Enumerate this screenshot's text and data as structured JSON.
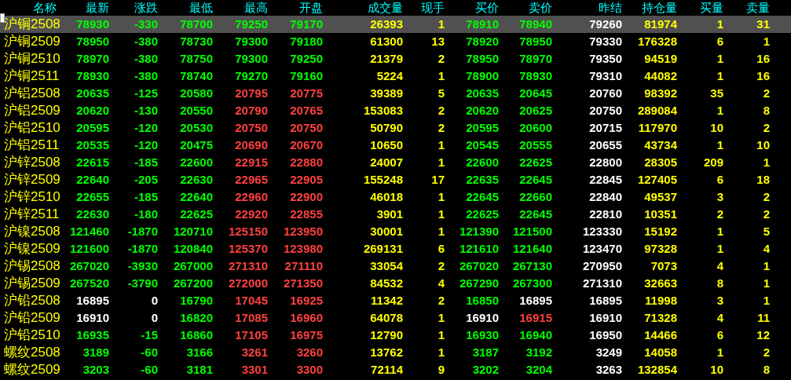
{
  "columns": [
    "名称",
    "最新",
    "涨跌",
    "最低",
    "最高",
    "开盘",
    "成交量",
    "现手",
    "买价",
    "卖价",
    "昨结",
    "持仓量",
    "买量",
    "卖量"
  ],
  "rows": [
    {
      "selected": true,
      "cells": [
        "沪铜2508",
        "78930",
        "-330",
        "78700",
        "79250",
        "79170",
        "26393",
        "1",
        "78910",
        "78940",
        "79260",
        "81974",
        "1",
        "31"
      ]
    },
    {
      "selected": false,
      "cells": [
        "沪铜2509",
        "78950",
        "-380",
        "78730",
        "79300",
        "79180",
        "61300",
        "13",
        "78920",
        "78950",
        "79330",
        "176328",
        "6",
        "1"
      ]
    },
    {
      "selected": false,
      "cells": [
        "沪铜2510",
        "78970",
        "-380",
        "78750",
        "79300",
        "79250",
        "21379",
        "2",
        "78950",
        "78970",
        "79350",
        "94519",
        "1",
        "16"
      ]
    },
    {
      "selected": false,
      "cells": [
        "沪铜2511",
        "78930",
        "-380",
        "78740",
        "79270",
        "79160",
        "5224",
        "1",
        "78900",
        "78930",
        "79310",
        "44082",
        "1",
        "16"
      ]
    },
    {
      "selected": false,
      "cells": [
        "沪铝2508",
        "20635",
        "-125",
        "20580",
        "20795",
        "20775",
        "39389",
        "5",
        "20635",
        "20645",
        "20760",
        "98392",
        "35",
        "2"
      ]
    },
    {
      "selected": false,
      "cells": [
        "沪铝2509",
        "20620",
        "-130",
        "20550",
        "20790",
        "20765",
        "153083",
        "2",
        "20620",
        "20625",
        "20750",
        "289084",
        "1",
        "8"
      ]
    },
    {
      "selected": false,
      "cells": [
        "沪铝2510",
        "20595",
        "-120",
        "20530",
        "20750",
        "20750",
        "50790",
        "2",
        "20595",
        "20600",
        "20715",
        "117970",
        "10",
        "2"
      ]
    },
    {
      "selected": false,
      "cells": [
        "沪铝2511",
        "20535",
        "-120",
        "20475",
        "20690",
        "20670",
        "10650",
        "1",
        "20545",
        "20555",
        "20655",
        "43734",
        "1",
        "10"
      ]
    },
    {
      "selected": false,
      "cells": [
        "沪锌2508",
        "22615",
        "-185",
        "22600",
        "22915",
        "22880",
        "24007",
        "1",
        "22600",
        "22625",
        "22800",
        "28305",
        "209",
        "1"
      ]
    },
    {
      "selected": false,
      "cells": [
        "沪锌2509",
        "22640",
        "-205",
        "22630",
        "22965",
        "22905",
        "155248",
        "17",
        "22635",
        "22645",
        "22845",
        "127405",
        "6",
        "18"
      ]
    },
    {
      "selected": false,
      "cells": [
        "沪锌2510",
        "22655",
        "-185",
        "22640",
        "22960",
        "22900",
        "46018",
        "1",
        "22645",
        "22660",
        "22840",
        "49537",
        "3",
        "2"
      ]
    },
    {
      "selected": false,
      "cells": [
        "沪锌2511",
        "22630",
        "-180",
        "22625",
        "22920",
        "22855",
        "3901",
        "1",
        "22625",
        "22645",
        "22810",
        "10351",
        "2",
        "2"
      ]
    },
    {
      "selected": false,
      "cells": [
        "沪镍2508",
        "121460",
        "-1870",
        "120710",
        "125150",
        "123950",
        "30001",
        "1",
        "121390",
        "121500",
        "123330",
        "15192",
        "1",
        "5"
      ]
    },
    {
      "selected": false,
      "cells": [
        "沪镍2509",
        "121600",
        "-1870",
        "120840",
        "125370",
        "123980",
        "269131",
        "6",
        "121610",
        "121640",
        "123470",
        "97328",
        "1",
        "4"
      ]
    },
    {
      "selected": false,
      "cells": [
        "沪锡2508",
        "267020",
        "-3930",
        "267000",
        "271310",
        "271110",
        "33054",
        "2",
        "267020",
        "267130",
        "270950",
        "7073",
        "4",
        "1"
      ]
    },
    {
      "selected": false,
      "cells": [
        "沪锡2509",
        "267520",
        "-3790",
        "267200",
        "272000",
        "271350",
        "84532",
        "4",
        "267290",
        "267300",
        "271310",
        "32663",
        "8",
        "1"
      ]
    },
    {
      "selected": false,
      "cells": [
        "沪铅2508",
        "16895",
        "0",
        "16790",
        "17045",
        "16925",
        "11342",
        "2",
        "16850",
        "16895",
        "16895",
        "11998",
        "3",
        "1"
      ]
    },
    {
      "selected": false,
      "cells": [
        "沪铅2509",
        "16910",
        "0",
        "16820",
        "17085",
        "16960",
        "64078",
        "1",
        "16910",
        "16915",
        "16910",
        "71328",
        "4",
        "11"
      ]
    },
    {
      "selected": false,
      "cells": [
        "沪铅2510",
        "16935",
        "-15",
        "16860",
        "17105",
        "16975",
        "12790",
        "1",
        "16930",
        "16940",
        "16950",
        "14466",
        "6",
        "12"
      ]
    },
    {
      "selected": false,
      "cells": [
        "螺纹2508",
        "3189",
        "-60",
        "3166",
        "3261",
        "3260",
        "13762",
        "1",
        "3187",
        "3192",
        "3249",
        "14058",
        "1",
        "2"
      ]
    },
    {
      "selected": false,
      "cells": [
        "螺纹2509",
        "3203",
        "-60",
        "3181",
        "3301",
        "3300",
        "72114",
        "9",
        "3202",
        "3204",
        "3263",
        "132854",
        "10",
        "8"
      ]
    }
  ]
}
